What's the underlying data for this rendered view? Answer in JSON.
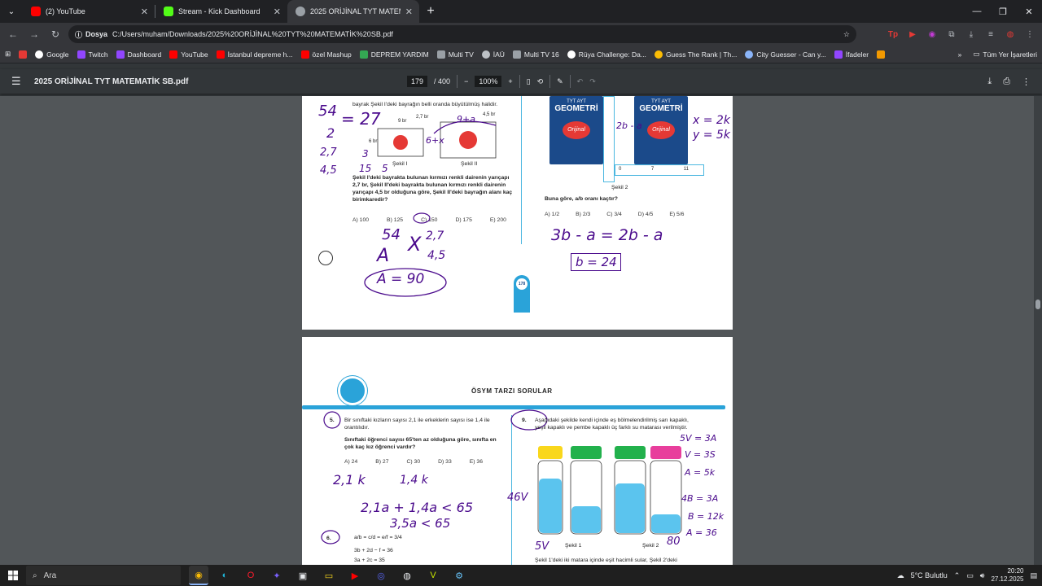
{
  "tabs": [
    {
      "title": "(2) YouTube",
      "color": "#ff0000"
    },
    {
      "title": "Stream - Kick Dashboard",
      "color": "#53fc18"
    },
    {
      "title": "2025 ORİJİNAL TYT MATEMATİK",
      "color": "#9aa0a6"
    }
  ],
  "toolbar": {
    "chip": "Dosya",
    "url": "C:/Users/muham/Downloads/2025%20ORİJİNAL%20TYT%20MATEMATİK%20SB.pdf"
  },
  "bookmarks": [
    "Google",
    "Twitch",
    "Dashboard",
    "YouTube",
    "İstanbul depreme h...",
    "özel Mashup",
    "DEPREM YARDIM",
    "Multi TV",
    "İAÜ",
    "Multi TV 16",
    "Rüya Challenge: Da...",
    "Guess The Rank | Th...",
    "City Guesser - Can y...",
    "İfadeler"
  ],
  "bookmarks_all": "Tüm Yer İşaretleri",
  "pdf": {
    "file_name": "2025 ORİJİNAL TYT MATEMATİK SB.pdf",
    "page_current": "179",
    "page_total": "/ 400",
    "zoom": "100%"
  },
  "page1": {
    "intro": "bayrak Şekil I'deki bayrağın belli oranda büyütülmüş halidir.",
    "fig1_label": "Şekil I",
    "fig2_label": "Şekil II",
    "dim1": "9 br",
    "dim2": "2,7 br",
    "dim3": "4,5 br",
    "dim4": "6 br",
    "question": "Şekil I'deki bayrakta bulunan kırmızı renkli dairenin yarıçapı 2,7 br, Şekil II'deki bayrakta bulunan kırmızı renkli dairenin yarıçapı 4,5 br olduğuna göre, Şekil II'deki bayrağın alanı kaç birimkaredir?",
    "answers": [
      "A) 100",
      "B) 125",
      "C) 150",
      "D) 175",
      "E) 200"
    ],
    "right_question": "Buna göre, a/b oranı kaçtır?",
    "right_answers": [
      "A) 1/2",
      "B) 2/3",
      "C) 3/4",
      "D) 4/5",
      "E) 5/6"
    ],
    "sekil2": "Şekil 2",
    "book_title": "GEOMETRİ",
    "book_sub": "TYT AYT",
    "book_brand": "Orijinal",
    "scale_labels": [
      "0",
      "7",
      "11"
    ],
    "page_number": "178",
    "ink": {
      "a": "54",
      "b": "2",
      "c": "= 27",
      "d": "2,7",
      "e": "4,5",
      "f": "3",
      "g": "15",
      "h": "5",
      "i": "9+a",
      "j": "6+x",
      "k": "A",
      "l": "A = 90",
      "m": "3b - a = 2b - a",
      "n": "b = 24",
      "o": "x = 2k",
      "p": "y = 5k",
      "q": "2b - a"
    }
  },
  "page2": {
    "header": "ÖSYM TARZI SORULAR",
    "q5_num": "5.",
    "q5_text1": "Bir sınıftaki kızların sayısı 2,1 ile erkeklerin sayısı ise 1,4 ile orantılıdır.",
    "q5_text2": "Sınıftaki öğrenci sayısı 65'ten az olduğuna göre, sınıfta en çok kaç kız öğrenci vardır?",
    "q5_answers": [
      "A) 24",
      "B) 27",
      "C) 30",
      "D) 33",
      "E) 36"
    ],
    "q6_num": "6.",
    "q6_eq1": "a/b = c/d = e/f = 3/4",
    "q6_eq2": "3b + 2d − f = 36",
    "q6_eq3": "3a + 2c = 35",
    "q9_num": "9.",
    "q9_text": "Aşağıdaki şekilde kendi içinde eş bölmelendirilmiş sarı kapaklı, yeşil kapaklı ve pembe kapaklı üç farklı su matarası verilmiştir.",
    "q9_footer": "Şekil 1'deki iki matara içinde eşit hacimli sular, Şekil 2'deki",
    "sekil1": "Şekil 1",
    "sekil2": "Şekil 2",
    "ink": {
      "a": "2,1 k",
      "b": "1,4 k",
      "c": "2,1a + 1,4a < 65",
      "d": "3,5a < 65",
      "e": "5V = 3A",
      "f": "V = 3S",
      "g": "A = 5k",
      "h": "4B = 3A",
      "i": "B = 12k",
      "j": "A = 36",
      "k": "46V",
      "l": "5V",
      "m": "80"
    }
  },
  "taskbar": {
    "search": "Ara",
    "weather": "5°C  Bulutlu",
    "time": "20:20",
    "date": "27.12.2025"
  }
}
